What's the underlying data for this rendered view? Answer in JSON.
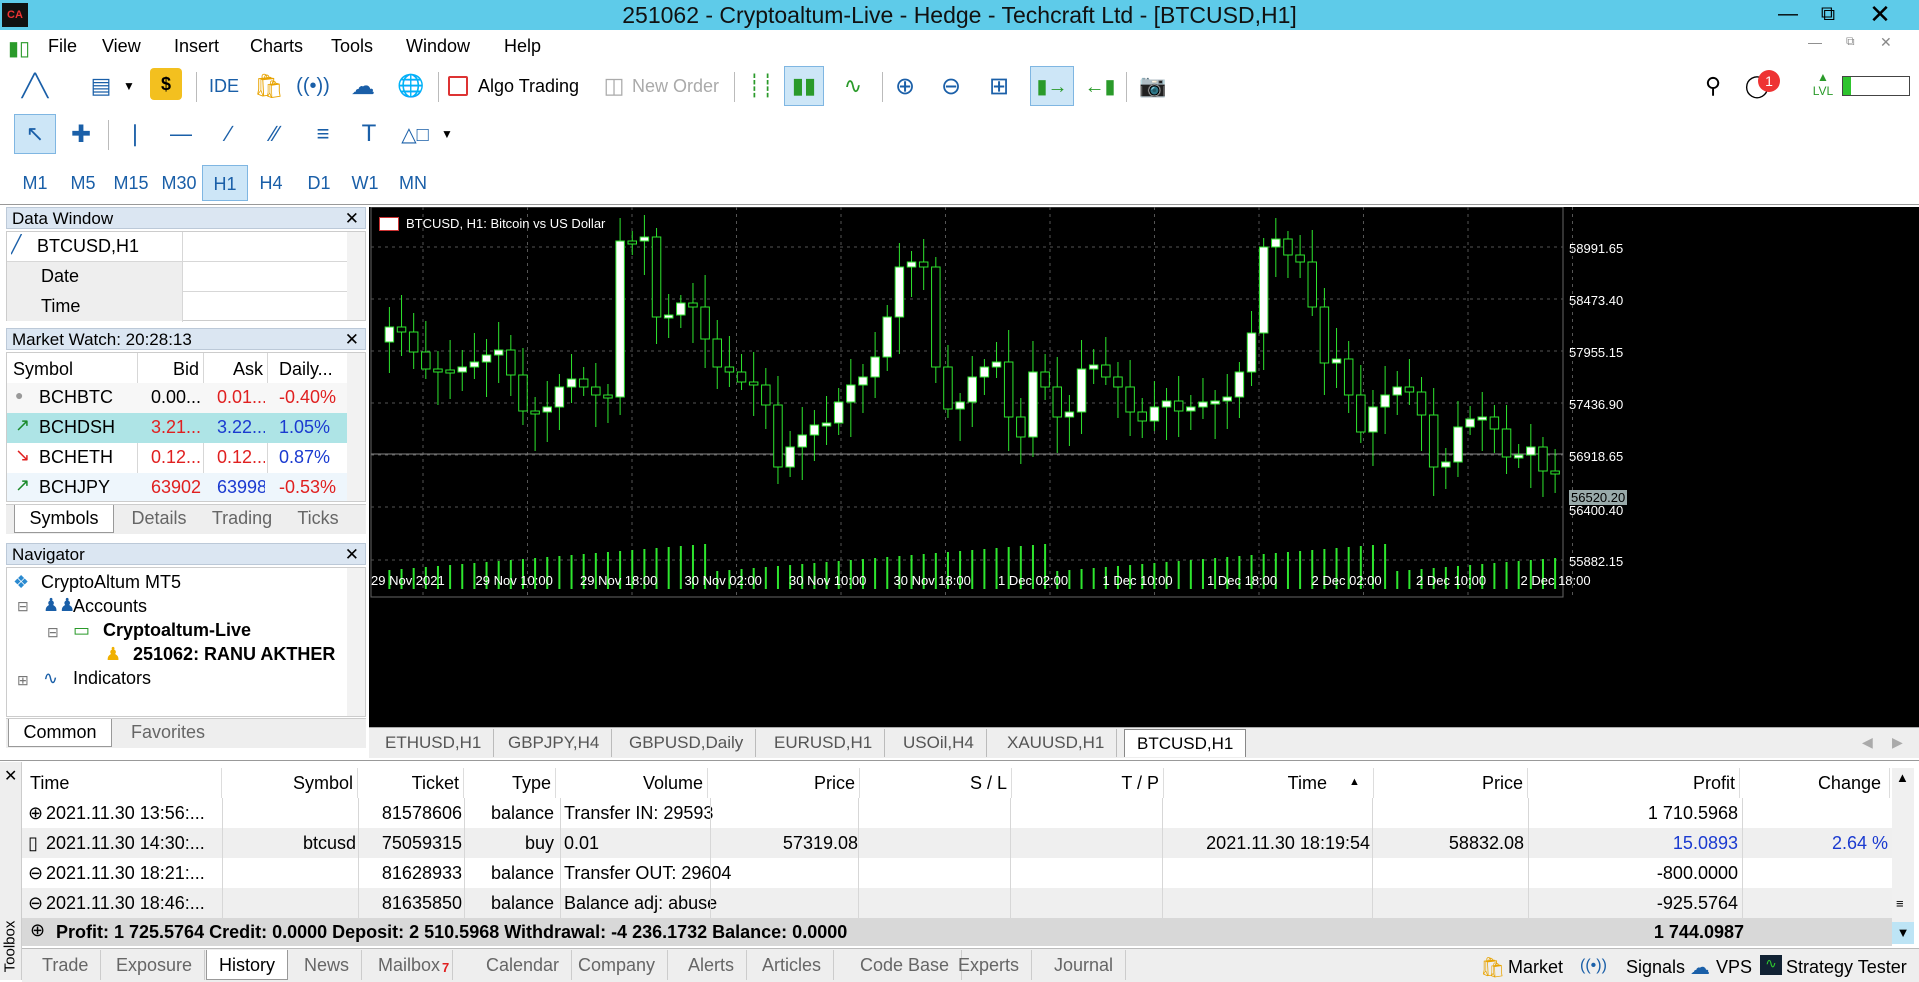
{
  "window": {
    "title": "251062 - Cryptoaltum-Live - Hedge - Techcraft Ltd - [BTCUSD,H1]",
    "logo": "CA"
  },
  "menu": [
    "File",
    "View",
    "Insert",
    "Charts",
    "Tools",
    "Window",
    "Help"
  ],
  "toolbar": {
    "ide": "IDE",
    "algo": "Algo Trading",
    "new_order": "New Order",
    "notif_count": "1",
    "lvl": "LVL"
  },
  "timeframes": [
    "M1",
    "M5",
    "M15",
    "M30",
    "H1",
    "H4",
    "D1",
    "W1",
    "MN"
  ],
  "timeframe_selected": "H1",
  "data_window": {
    "title": "Data Window",
    "symbol": "BTCUSD,H1",
    "rows": [
      "Date",
      "Time"
    ]
  },
  "market_watch": {
    "title": "Market Watch: 20:28:13",
    "headers": [
      "Symbol",
      "Bid",
      "Ask",
      "Daily..."
    ],
    "rows": [
      {
        "symbol": "BCHBTC",
        "bid": "0.00...",
        "ask": "0.01...",
        "daily": "-0.40%",
        "dir": "dot"
      },
      {
        "symbol": "BCHDSH",
        "bid": "3.21...",
        "ask": "3.22...",
        "daily": "1.05%",
        "dir": "up"
      },
      {
        "symbol": "BCHETH",
        "bid": "0.12...",
        "ask": "0.12...",
        "daily": "0.87%",
        "dir": "down"
      },
      {
        "symbol": "BCHJPY",
        "bid": "63902",
        "ask": "63998",
        "daily": "-0.53%",
        "dir": "up"
      }
    ],
    "tabs": [
      "Symbols",
      "Details",
      "Trading",
      "Ticks"
    ]
  },
  "navigator": {
    "title": "Navigator",
    "items": [
      "CryptoAltum MT5",
      "Accounts",
      "Cryptoaltum-Live",
      "251062: RANU AKTHER",
      "Indicators"
    ],
    "tabs": [
      "Common",
      "Favorites"
    ]
  },
  "chart": {
    "label": "BTCUSD, H1:  Bitcoin vs US Dollar",
    "price_labels": [
      "58991.65",
      "58473.40",
      "57955.15",
      "57436.90",
      "56918.65",
      "56520.20",
      "56400.40",
      "55882.15"
    ],
    "time_labels": [
      "29 Nov 2021",
      "29 Nov 10:00",
      "29 Nov 18:00",
      "30 Nov 02:00",
      "30 Nov 10:00",
      "30 Nov 18:00",
      "1 Dec 02:00",
      "1 Dec 10:00",
      "1 Dec 18:00",
      "2 Dec 02:00",
      "2 Dec 10:00",
      "2 Dec 18:00"
    ],
    "tabs": [
      "ETHUSD,H1",
      "GBPJPY,H4",
      "GBPUSD,Daily",
      "EURUSD,H1",
      "USOil,H4",
      "XAUUSD,H1",
      "BTCUSD,H1"
    ]
  },
  "history": {
    "headers": [
      "Time",
      "Symbol",
      "Ticket",
      "Type",
      "Volume",
      "Price",
      "S / L",
      "T / P",
      "Time",
      "Price",
      "Profit",
      "Change"
    ],
    "rows": [
      {
        "time": "2021.11.30 13:56:...",
        "symbol": "",
        "ticket": "81578606",
        "type": "balance",
        "volume": "Transfer IN: 29593",
        "price": "",
        "sl": "",
        "tp": "",
        "time2": "",
        "price2": "",
        "profit": "1 710.5968",
        "change": ""
      },
      {
        "time": "2021.11.30 14:30:...",
        "symbol": "btcusd",
        "ticket": "75059315",
        "type": "buy",
        "volume": "0.01",
        "price": "57319.08",
        "sl": "",
        "tp": "",
        "time2": "2021.11.30 18:19:54",
        "price2": "58832.08",
        "profit": "15.0893",
        "change": "2.64 %"
      },
      {
        "time": "2021.11.30 18:21:...",
        "symbol": "",
        "ticket": "81628933",
        "type": "balance",
        "volume": "Transfer OUT: 29604",
        "price": "",
        "sl": "",
        "tp": "",
        "time2": "",
        "price2": "",
        "profit": "-800.0000",
        "change": ""
      },
      {
        "time": "2021.11.30 18:46:...",
        "symbol": "",
        "ticket": "81635850",
        "type": "balance",
        "volume": "Balance adj: abuse",
        "price": "",
        "sl": "",
        "tp": "",
        "time2": "",
        "price2": "",
        "profit": "-925.5764",
        "change": ""
      }
    ],
    "summary": "Profit: 1 725.5764  Credit: 0.0000  Deposit: 2 510.5968  Withdrawal: -4 236.1732  Balance: 0.0000",
    "summary_total": "1 744.0987"
  },
  "toolbox": {
    "label": "Toolbox",
    "tabs": [
      "Trade",
      "Exposure",
      "History",
      "News",
      "Mailbox",
      "Calendar",
      "Company",
      "Alerts",
      "Articles",
      "Code Base",
      "Experts",
      "Journal"
    ],
    "mailbox_count": "7",
    "right": [
      "Market",
      "Signals",
      "VPS",
      "Strategy Tester"
    ]
  }
}
